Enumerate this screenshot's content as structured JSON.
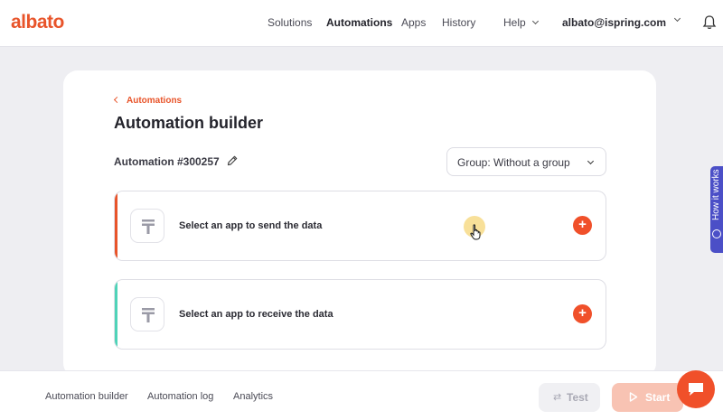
{
  "header": {
    "logo": "albato",
    "nav": [
      "Solutions",
      "Automations",
      "Apps",
      "History"
    ],
    "help": "Help",
    "user": "albato@ispring.com"
  },
  "breadcrumb": {
    "back_label": "Automations"
  },
  "page": {
    "title": "Automation builder",
    "automation_id": "Automation #300257",
    "group_select": "Group: Without a group"
  },
  "steps": [
    {
      "label": "Select an app to send the data",
      "accent": "#e8542a"
    },
    {
      "label": "Select an app to receive the data",
      "accent": "#4fd3b8"
    }
  ],
  "side_tab": {
    "label": "How it works"
  },
  "footer": {
    "links": [
      "Automation builder",
      "Automation log",
      "Analytics"
    ],
    "test_label": "Test",
    "start_label": "Start"
  },
  "colors": {
    "brand": "#e8542a",
    "side_tab": "#4b4fc7"
  }
}
